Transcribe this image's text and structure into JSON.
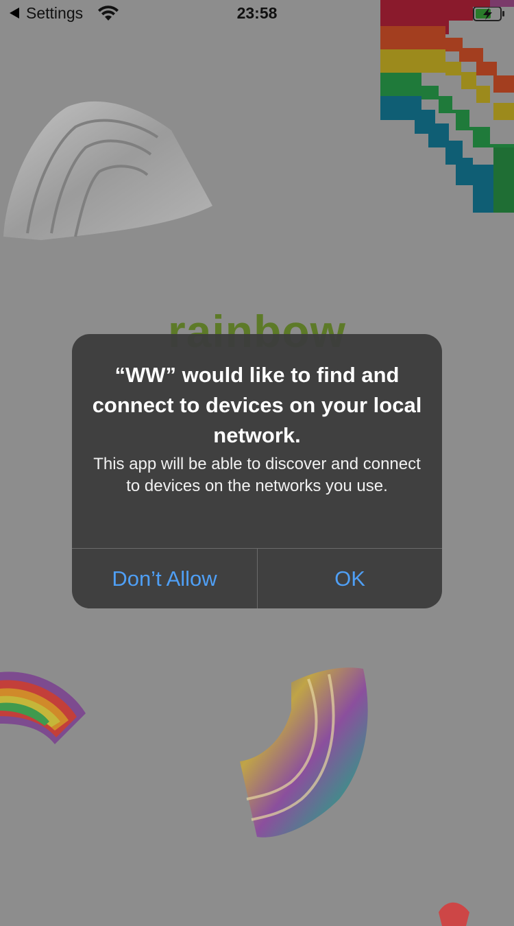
{
  "status_bar": {
    "back_label": "Settings",
    "time": "23:58",
    "icons": [
      "back-arrow-icon",
      "wifi-icon",
      "battery-charging-icon"
    ]
  },
  "background": {
    "brand_word": "rainbow"
  },
  "alert": {
    "title": "“WW” would like to find and connect to devices on your local network.",
    "message": "This app will be able to discover and connect to devices on the networks you use.",
    "buttons": {
      "deny_label": "Don’t Allow",
      "ok_label": "OK"
    }
  },
  "colors": {
    "button_text": "#4f9ff5",
    "alert_bg": "#3c3c3c",
    "overlay": "#8d8d8d"
  }
}
